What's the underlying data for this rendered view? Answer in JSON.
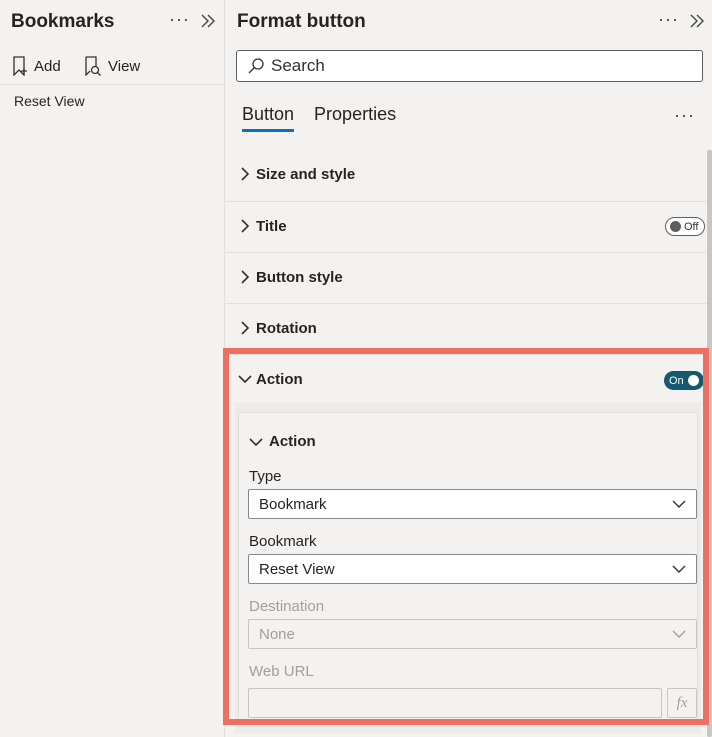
{
  "bookmarks": {
    "title": "Bookmarks",
    "more_label": "···",
    "toolbar": {
      "add_label": "Add",
      "view_label": "View"
    },
    "items": [
      {
        "label": "Reset View"
      }
    ]
  },
  "format": {
    "title": "Format button",
    "more_label": "···",
    "search": {
      "placeholder": "Search",
      "value": ""
    },
    "tabs": [
      {
        "label": "Button",
        "active": true
      },
      {
        "label": "Properties",
        "active": false
      }
    ],
    "tabs_more_label": "···",
    "sections": [
      {
        "label": "Size and style",
        "expanded": false
      },
      {
        "label": "Title",
        "expanded": false,
        "toggle": "Off"
      },
      {
        "label": "Button style",
        "expanded": false
      },
      {
        "label": "Rotation",
        "expanded": false
      },
      {
        "label": "Action",
        "expanded": true,
        "toggle": "On"
      }
    ],
    "action_card": {
      "title": "Action",
      "type": {
        "label": "Type",
        "value": "Bookmark"
      },
      "bookmark": {
        "label": "Bookmark",
        "value": "Reset View"
      },
      "destination": {
        "label": "Destination",
        "value": "None",
        "disabled": true
      },
      "web_url": {
        "label": "Web URL",
        "value": "",
        "disabled": true
      },
      "fx_label": "fx"
    }
  },
  "colors": {
    "accent_tab": "#106ebe",
    "toggle_on": "#14596e",
    "highlight": "#ef6f63"
  }
}
